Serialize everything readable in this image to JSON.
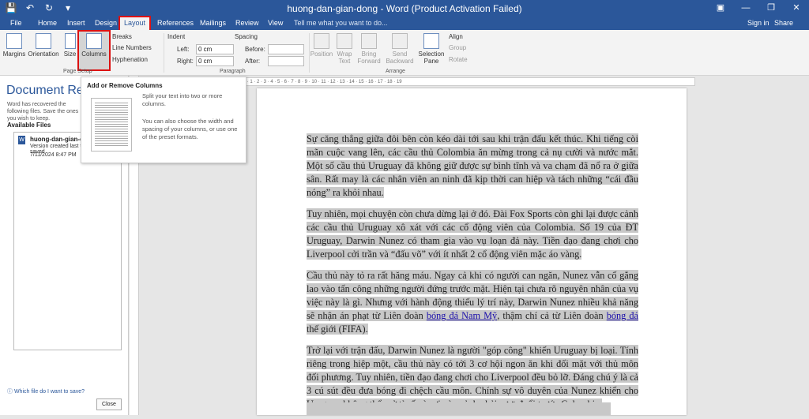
{
  "window": {
    "title": "huong-dan-gian-dong - Word (Product Activation Failed)"
  },
  "tabs": [
    "File",
    "Home",
    "Insert",
    "Design",
    "Layout",
    "References",
    "Mailings",
    "Review",
    "View"
  ],
  "tellme": "Tell me what you want to do...",
  "account": {
    "signin": "Sign in",
    "share": "Share"
  },
  "ribbon": {
    "page_setup": {
      "margins": "Margins",
      "orientation": "Orientation",
      "size": "Size",
      "columns": "Columns",
      "breaks": "Breaks",
      "line_numbers": "Line Numbers",
      "hyphenation": "Hyphenation",
      "group": "Page Setup"
    },
    "paragraph": {
      "indent": "Indent",
      "left_label": "Left:",
      "left_value": "0 cm",
      "right_label": "Right:",
      "right_value": "0 cm",
      "spacing": "Spacing",
      "before_label": "Before:",
      "after_label": "After:",
      "group": "Paragraph"
    },
    "arrange": {
      "position": "Position",
      "wrap": "Wrap\nText",
      "bring": "Bring\nForward",
      "send": "Send\nBackward",
      "selection": "Selection\nPane",
      "align": "Align",
      "group_btn": "Group",
      "rotate": "Rotate",
      "group": "Arrange"
    }
  },
  "pane": {
    "title": "Document Recovery",
    "desc": "Word has recovered the following files. Save the ones you wish to keep.",
    "available": "Available Files",
    "file_name": "huong-dan-gian-dong",
    "file_status": "Version created last time the user saved",
    "file_time": "7/11/2024 8:47 PM",
    "help": "Which file do I want to save?",
    "close": "Close"
  },
  "tooltip": {
    "title": "Add or Remove Columns",
    "text1": "Split your text into two or more columns.",
    "text2": "You can also choose the width and spacing of your columns, or use one of the preset formats."
  },
  "document": {
    "p1": "Sự căng thẳng giữa đôi bên còn kéo dài tới sau khi trận đấu kết thúc. Khi tiếng còi mãn cuộc vang lên, các cầu thủ Colombia ăn mừng trong cả nụ cười và nước mắt. Một số cầu thủ Uruguay đã không giữ được sự bình tĩnh và va chạm đã nổ ra ở giữa sân. Rất may là các nhân viên an ninh đã kịp thời can hiệp và tách những “cái đầu nóng” ra khỏi nhau.",
    "p2": "Tuy nhiên, mọi chuyện còn chưa dừng lại ở đó. Đài Fox Sports còn ghi lại được cảnh các cầu thủ Uruguay xô xát với các cổ động viên của Colombia. Số 19 của ĐT Uruguay, Darwin Nunez có tham gia vào vụ loạn đả này. Tiền đạo đang chơi cho Liverpool cởi trần và “đấu võ” với ít nhất 2 cổ động viên mặc áo vàng.",
    "p3a": "Cầu thủ này tỏ ra rất hăng máu. Ngay cả khi có người can ngăn, Nunez vẫn cố gắng lao vào tấn công những người đứng trước mặt. Hiện tại chưa rõ nguyên nhân của vụ việc này là gì. Nhưng với hành động thiếu lý trí này, Darwin Nunez nhiều khả năng sẽ nhận án phạt từ Liên đoàn ",
    "link1": "bóng đá Nam Mỹ",
    "p3b": ", thậm chí cả từ Liên đoàn ",
    "link2": "bóng đá",
    "p3c": " thế giới (FIFA).",
    "p4": "Trở lại với trận đấu, Darwin Nunez là người \"góp công\" khiến Uruguay bị loại. Tính riêng trong hiệp một, cầu thủ này có tới 3 cơ hội ngon ăn khi đối mặt với thủ môn đối phương. Tuy nhiên, tiền đạo đang chơi cho Liverpool đều bỏ lỡ. Đáng chú ý là cả 3 cú sút đều đưa bóng đi chệch cầu môn. Chính sự vô duyên của Nunez khiến cho Uruguay không thể mở tỉ số và rơi vào cảnh phải rượt đuổi trước Colombia."
  }
}
